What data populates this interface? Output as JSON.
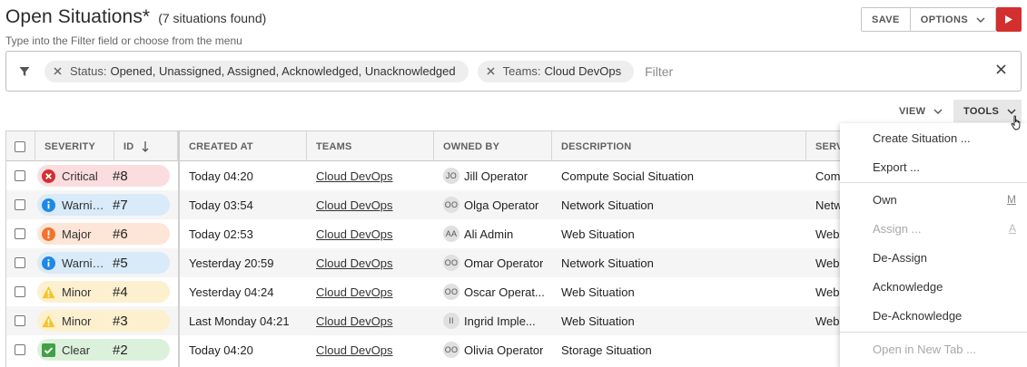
{
  "header": {
    "title": "Open Situations*",
    "count": "(7 situations found)",
    "hint": "Type into the Filter field or choose from the menu",
    "save_label": "SAVE",
    "options_label": "OPTIONS"
  },
  "filter": {
    "chips": [
      {
        "key": "Status:",
        "value": "Opened, Unassigned, Assigned, Acknowledged, Unacknowledged"
      },
      {
        "key": "Teams:",
        "value": "Cloud DevOps"
      }
    ],
    "placeholder": "Filter"
  },
  "toolbar": {
    "view_label": "VIEW",
    "tools_label": "TOOLS"
  },
  "table": {
    "columns": [
      "SEVERITY",
      "ID",
      "CREATED AT",
      "TEAMS",
      "OWNED BY",
      "DESCRIPTION",
      "SERV"
    ],
    "rows": [
      {
        "severity": "Critical",
        "id": "#8",
        "created": "Today 04:20",
        "team": "Cloud DevOps",
        "initials": "JO",
        "owner": "Jill Operator",
        "description": "Compute Social Situation",
        "service": "Com"
      },
      {
        "severity": "Warning",
        "id": "#7",
        "created": "Today 03:54",
        "team": "Cloud DevOps",
        "initials": "OO",
        "owner": "Olga Operator",
        "description": "Network Situation",
        "service": "Netw"
      },
      {
        "severity": "Major",
        "id": "#6",
        "created": "Today 02:53",
        "team": "Cloud DevOps",
        "initials": "AA",
        "owner": "Ali Admin",
        "description": "Web Situation",
        "service": "Web"
      },
      {
        "severity": "Warning",
        "id": "#5",
        "created": "Yesterday 20:59",
        "team": "Cloud DevOps",
        "initials": "OO",
        "owner": "Omar Operator",
        "description": "Network Situation",
        "service": "Web"
      },
      {
        "severity": "Minor",
        "id": "#4",
        "created": "Yesterday 04:24",
        "team": "Cloud DevOps",
        "initials": "OO",
        "owner": "Oscar Operat...",
        "description": "Web Situation",
        "service": "Web"
      },
      {
        "severity": "Minor",
        "id": "#3",
        "created": "Last Monday 04:21",
        "team": "Cloud DevOps",
        "initials": "II",
        "owner": "Ingrid Imple...",
        "description": "Web Situation",
        "service": "Web"
      },
      {
        "severity": "Clear",
        "id": "#2",
        "created": "Today 04:20",
        "team": "Cloud DevOps",
        "initials": "OO",
        "owner": "Olivia Operator",
        "description": "Storage Situation",
        "service": ""
      }
    ]
  },
  "severity_styles": {
    "Critical": {
      "bg": "#fbdde0",
      "icon": "#d32f2f"
    },
    "Warning": {
      "bg": "#d9eaf9",
      "icon": "#1e88e5"
    },
    "Major": {
      "bg": "#fde5d8",
      "icon": "#f4722b"
    },
    "Minor": {
      "bg": "#fcf0cf",
      "icon": "#f7c325"
    },
    "Clear": {
      "bg": "#dcf1dc",
      "icon": "#43a047"
    }
  },
  "tools_menu": {
    "items": [
      {
        "label": "Create Situation ...",
        "shortcut": "",
        "disabled": false
      },
      {
        "label": "Export ...",
        "shortcut": "",
        "disabled": false
      },
      {
        "label": "Own",
        "shortcut": "M",
        "disabled": false
      },
      {
        "label": "Assign ...",
        "shortcut": "A",
        "disabled": true
      },
      {
        "label": "De-Assign",
        "shortcut": "",
        "disabled": false
      },
      {
        "label": "Acknowledge",
        "shortcut": "",
        "disabled": false
      },
      {
        "label": "De-Acknowledge",
        "shortcut": "",
        "disabled": false
      },
      {
        "label": "Open in New Tab ...",
        "shortcut": "",
        "disabled": true
      }
    ]
  },
  "colors": {
    "accent_red": "#d32f2f"
  }
}
